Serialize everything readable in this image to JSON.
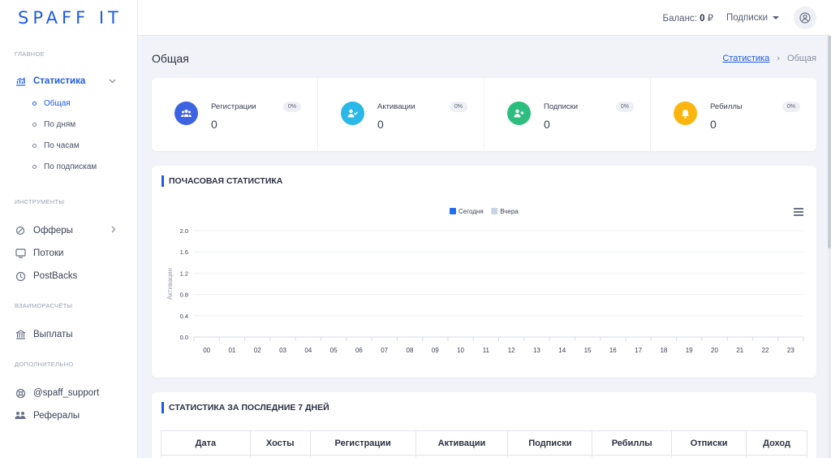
{
  "brand": {
    "logo": "SPAFF IT"
  },
  "topbar": {
    "balance_label": "Баланс:",
    "balance_value": "0",
    "currency": "₽",
    "subscriptions_label": "Подписки"
  },
  "sidebar": {
    "section_main": "ГЛАВНОЕ",
    "statistics": "Статистика",
    "sub_items": [
      "Общая",
      "По дням",
      "По часам",
      "По подпискам"
    ],
    "section_tools": "ИНСТРУМЕНТЫ",
    "offers": "Офферы",
    "streams": "Потоки",
    "postbacks": "PostBacks",
    "section_settlements": "ВЗАИМОРАСЧЁТЫ",
    "payouts": "Выплаты",
    "section_extra": "ДОПОЛНИТЕЛЬНО",
    "support": "@spaff_support",
    "referrals": "Рефералы"
  },
  "page": {
    "title": "Общая",
    "breadcrumb_link": "Статистика",
    "breadcrumb_current": "Общая"
  },
  "stats": [
    {
      "label": "Регистрации",
      "value": "0",
      "badge": "0%",
      "color": "#3d63e3",
      "icon": "users-icon"
    },
    {
      "label": "Активации",
      "value": "0",
      "badge": "0%",
      "color": "#29b8e8",
      "icon": "user-check-icon"
    },
    {
      "label": "Подписки",
      "value": "0",
      "badge": "0%",
      "color": "#2dbd7e",
      "icon": "user-plus-icon"
    },
    {
      "label": "Ребиллы",
      "value": "0",
      "badge": "0%",
      "color": "#fbb50e",
      "icon": "bell-icon"
    }
  ],
  "hourly": {
    "title": "ПОЧАСОВАЯ СТАТИСТИКА"
  },
  "chart_data": {
    "type": "bar",
    "title": "",
    "ylabel": "Активации",
    "xlabel": "",
    "ylim": [
      0,
      2.0
    ],
    "yticks": [
      "0.0",
      "0.4",
      "0.8",
      "1.2",
      "1.6",
      "2.0"
    ],
    "categories": [
      "00",
      "01",
      "02",
      "03",
      "04",
      "05",
      "06",
      "07",
      "08",
      "09",
      "10",
      "11",
      "12",
      "13",
      "14",
      "15",
      "16",
      "17",
      "18",
      "19",
      "20",
      "21",
      "22",
      "23"
    ],
    "series": [
      {
        "name": "Сегодня",
        "color": "#1f6ef0",
        "values": [
          0,
          0,
          0,
          0,
          0,
          0,
          0,
          0,
          0,
          0,
          0,
          0,
          0,
          0,
          0,
          0,
          0,
          0,
          0,
          0,
          0,
          0,
          0,
          0
        ]
      },
      {
        "name": "Вчера",
        "color": "#c9d3e6",
        "values": [
          0,
          0,
          0,
          0,
          0,
          0,
          0,
          0,
          0,
          0,
          0,
          0,
          0,
          0,
          0,
          0,
          0,
          0,
          0,
          0,
          0,
          0,
          0,
          0
        ]
      }
    ],
    "legend": "top-center",
    "grid": true
  },
  "weekly": {
    "title": "СТАТИСТИКА ЗА ПОСЛЕДНИЕ 7 ДНЕЙ",
    "columns": [
      "Дата",
      "Хосты",
      "Регистрации",
      "Активации",
      "Подписки",
      "Ребиллы",
      "Отписки",
      "Доход"
    ]
  }
}
